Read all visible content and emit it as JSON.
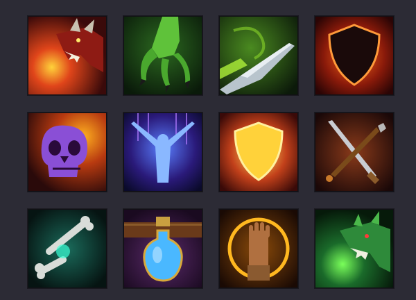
{
  "icons": [
    {
      "name": "red-dragon-fire-breath-icon",
      "accent": "#e0451a"
    },
    {
      "name": "green-claw-icon",
      "accent": "#5fc23a"
    },
    {
      "name": "poison-blade-icon",
      "accent": "#8ad62a"
    },
    {
      "name": "fire-shield-icon",
      "accent": "#ff6a1a"
    },
    {
      "name": "flaming-purple-skull-icon",
      "accent": "#8a4fd6"
    },
    {
      "name": "arcane-figure-ascending-icon",
      "accent": "#5a7fff"
    },
    {
      "name": "golden-holy-shield-icon",
      "accent": "#ffd23a"
    },
    {
      "name": "crossed-sword-and-mace-icon",
      "accent": "#c97a2a"
    },
    {
      "name": "glowing-bone-icon",
      "accent": "#3affd6"
    },
    {
      "name": "blue-potion-belt-icon",
      "accent": "#4ab8ff"
    },
    {
      "name": "golden-sigil-hand-icon",
      "accent": "#ffb820"
    },
    {
      "name": "green-dragon-poison-breath-icon",
      "accent": "#3ad65a"
    }
  ]
}
